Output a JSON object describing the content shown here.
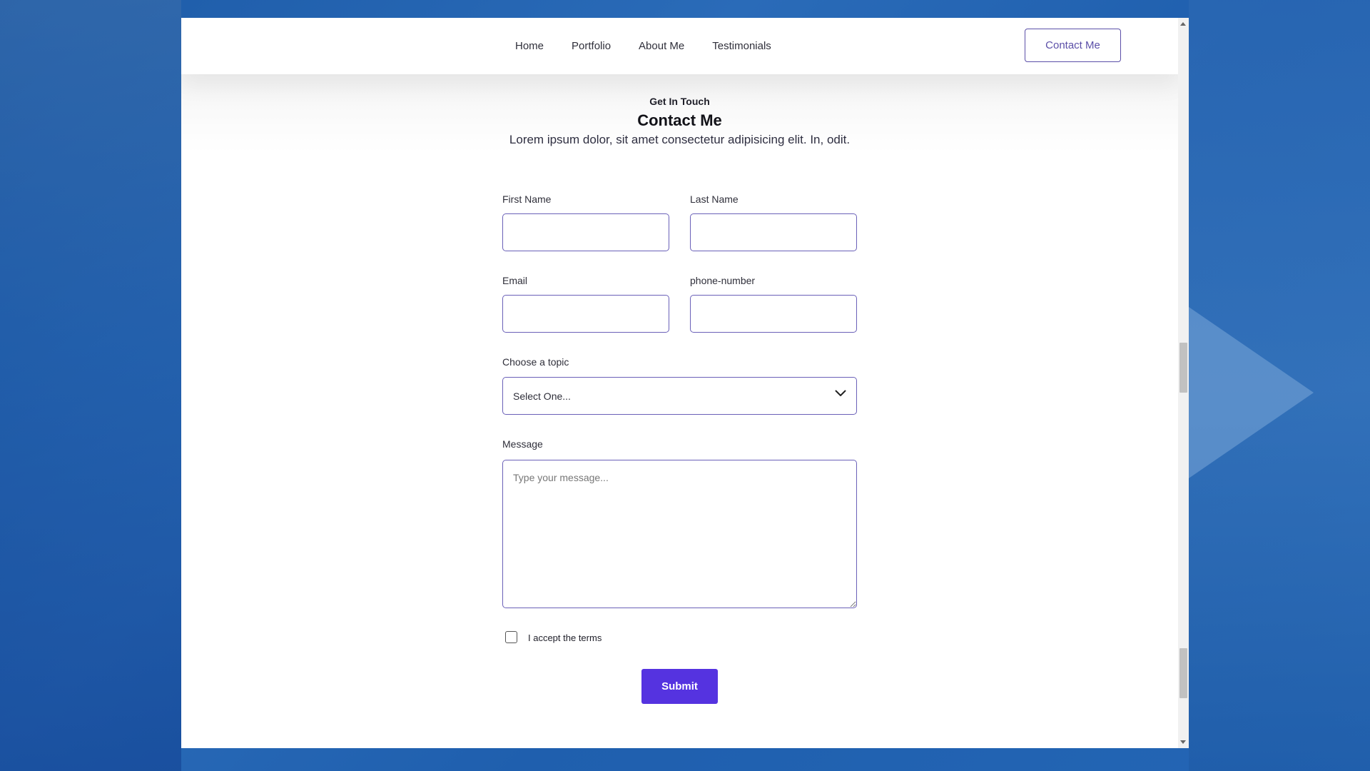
{
  "nav": {
    "links": [
      "Home",
      "Portfolio",
      "About Me",
      "Testimonials"
    ],
    "cta_label": "Contact Me"
  },
  "header": {
    "eyebrow": "Get In Touch",
    "title": "Contact Me",
    "subtitle": "Lorem ipsum dolor, sit amet consectetur adipisicing elit. In, odit."
  },
  "form": {
    "first_name_label": "First Name",
    "first_name_value": "",
    "last_name_label": "Last Name",
    "last_name_value": "",
    "email_label": "Email",
    "email_value": "",
    "phone_label": "phone-number",
    "phone_value": "",
    "topic_label": "Choose a topic",
    "topic_selected": "Select One...",
    "message_label": "Message",
    "message_placeholder": "Type your message...",
    "terms_label": "I accept the terms",
    "terms_checked": false,
    "submit_label": "Submit"
  },
  "icons": {
    "select_arrow": "chevron-down-icon",
    "scroll_up": "arrow-up-icon",
    "scroll_down": "arrow-down-icon"
  },
  "colors": {
    "accent": "#5533e0",
    "border": "#6a60b8",
    "background": "#1d5ba8"
  }
}
